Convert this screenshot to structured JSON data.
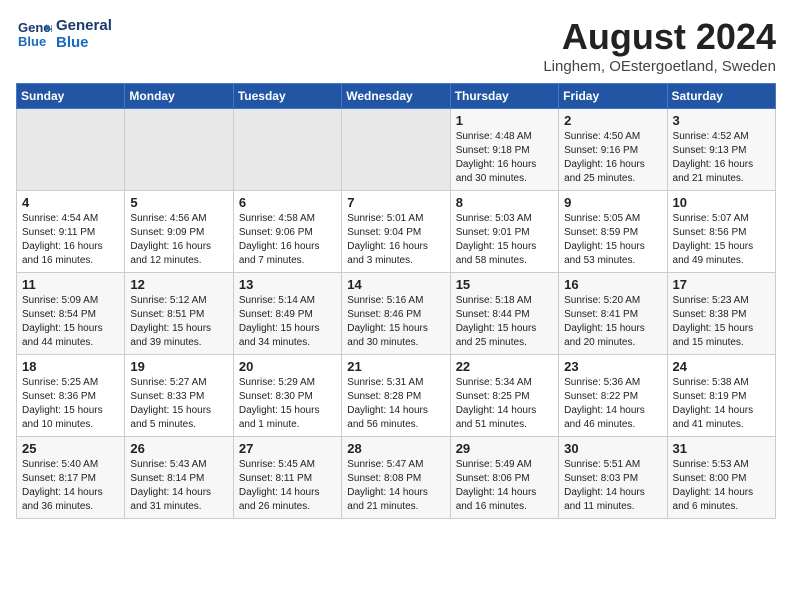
{
  "header": {
    "logo_line1": "General",
    "logo_line2": "Blue",
    "month_year": "August 2024",
    "location": "Linghem, OEstergoetland, Sweden"
  },
  "weekdays": [
    "Sunday",
    "Monday",
    "Tuesday",
    "Wednesday",
    "Thursday",
    "Friday",
    "Saturday"
  ],
  "weeks": [
    [
      {
        "day": "",
        "content": ""
      },
      {
        "day": "",
        "content": ""
      },
      {
        "day": "",
        "content": ""
      },
      {
        "day": "",
        "content": ""
      },
      {
        "day": "1",
        "content": "Sunrise: 4:48 AM\nSunset: 9:18 PM\nDaylight: 16 hours\nand 30 minutes."
      },
      {
        "day": "2",
        "content": "Sunrise: 4:50 AM\nSunset: 9:16 PM\nDaylight: 16 hours\nand 25 minutes."
      },
      {
        "day": "3",
        "content": "Sunrise: 4:52 AM\nSunset: 9:13 PM\nDaylight: 16 hours\nand 21 minutes."
      }
    ],
    [
      {
        "day": "4",
        "content": "Sunrise: 4:54 AM\nSunset: 9:11 PM\nDaylight: 16 hours\nand 16 minutes."
      },
      {
        "day": "5",
        "content": "Sunrise: 4:56 AM\nSunset: 9:09 PM\nDaylight: 16 hours\nand 12 minutes."
      },
      {
        "day": "6",
        "content": "Sunrise: 4:58 AM\nSunset: 9:06 PM\nDaylight: 16 hours\nand 7 minutes."
      },
      {
        "day": "7",
        "content": "Sunrise: 5:01 AM\nSunset: 9:04 PM\nDaylight: 16 hours\nand 3 minutes."
      },
      {
        "day": "8",
        "content": "Sunrise: 5:03 AM\nSunset: 9:01 PM\nDaylight: 15 hours\nand 58 minutes."
      },
      {
        "day": "9",
        "content": "Sunrise: 5:05 AM\nSunset: 8:59 PM\nDaylight: 15 hours\nand 53 minutes."
      },
      {
        "day": "10",
        "content": "Sunrise: 5:07 AM\nSunset: 8:56 PM\nDaylight: 15 hours\nand 49 minutes."
      }
    ],
    [
      {
        "day": "11",
        "content": "Sunrise: 5:09 AM\nSunset: 8:54 PM\nDaylight: 15 hours\nand 44 minutes."
      },
      {
        "day": "12",
        "content": "Sunrise: 5:12 AM\nSunset: 8:51 PM\nDaylight: 15 hours\nand 39 minutes."
      },
      {
        "day": "13",
        "content": "Sunrise: 5:14 AM\nSunset: 8:49 PM\nDaylight: 15 hours\nand 34 minutes."
      },
      {
        "day": "14",
        "content": "Sunrise: 5:16 AM\nSunset: 8:46 PM\nDaylight: 15 hours\nand 30 minutes."
      },
      {
        "day": "15",
        "content": "Sunrise: 5:18 AM\nSunset: 8:44 PM\nDaylight: 15 hours\nand 25 minutes."
      },
      {
        "day": "16",
        "content": "Sunrise: 5:20 AM\nSunset: 8:41 PM\nDaylight: 15 hours\nand 20 minutes."
      },
      {
        "day": "17",
        "content": "Sunrise: 5:23 AM\nSunset: 8:38 PM\nDaylight: 15 hours\nand 15 minutes."
      }
    ],
    [
      {
        "day": "18",
        "content": "Sunrise: 5:25 AM\nSunset: 8:36 PM\nDaylight: 15 hours\nand 10 minutes."
      },
      {
        "day": "19",
        "content": "Sunrise: 5:27 AM\nSunset: 8:33 PM\nDaylight: 15 hours\nand 5 minutes."
      },
      {
        "day": "20",
        "content": "Sunrise: 5:29 AM\nSunset: 8:30 PM\nDaylight: 15 hours\nand 1 minute."
      },
      {
        "day": "21",
        "content": "Sunrise: 5:31 AM\nSunset: 8:28 PM\nDaylight: 14 hours\nand 56 minutes."
      },
      {
        "day": "22",
        "content": "Sunrise: 5:34 AM\nSunset: 8:25 PM\nDaylight: 14 hours\nand 51 minutes."
      },
      {
        "day": "23",
        "content": "Sunrise: 5:36 AM\nSunset: 8:22 PM\nDaylight: 14 hours\nand 46 minutes."
      },
      {
        "day": "24",
        "content": "Sunrise: 5:38 AM\nSunset: 8:19 PM\nDaylight: 14 hours\nand 41 minutes."
      }
    ],
    [
      {
        "day": "25",
        "content": "Sunrise: 5:40 AM\nSunset: 8:17 PM\nDaylight: 14 hours\nand 36 minutes."
      },
      {
        "day": "26",
        "content": "Sunrise: 5:43 AM\nSunset: 8:14 PM\nDaylight: 14 hours\nand 31 minutes."
      },
      {
        "day": "27",
        "content": "Sunrise: 5:45 AM\nSunset: 8:11 PM\nDaylight: 14 hours\nand 26 minutes."
      },
      {
        "day": "28",
        "content": "Sunrise: 5:47 AM\nSunset: 8:08 PM\nDaylight: 14 hours\nand 21 minutes."
      },
      {
        "day": "29",
        "content": "Sunrise: 5:49 AM\nSunset: 8:06 PM\nDaylight: 14 hours\nand 16 minutes."
      },
      {
        "day": "30",
        "content": "Sunrise: 5:51 AM\nSunset: 8:03 PM\nDaylight: 14 hours\nand 11 minutes."
      },
      {
        "day": "31",
        "content": "Sunrise: 5:53 AM\nSunset: 8:00 PM\nDaylight: 14 hours\nand 6 minutes."
      }
    ]
  ]
}
